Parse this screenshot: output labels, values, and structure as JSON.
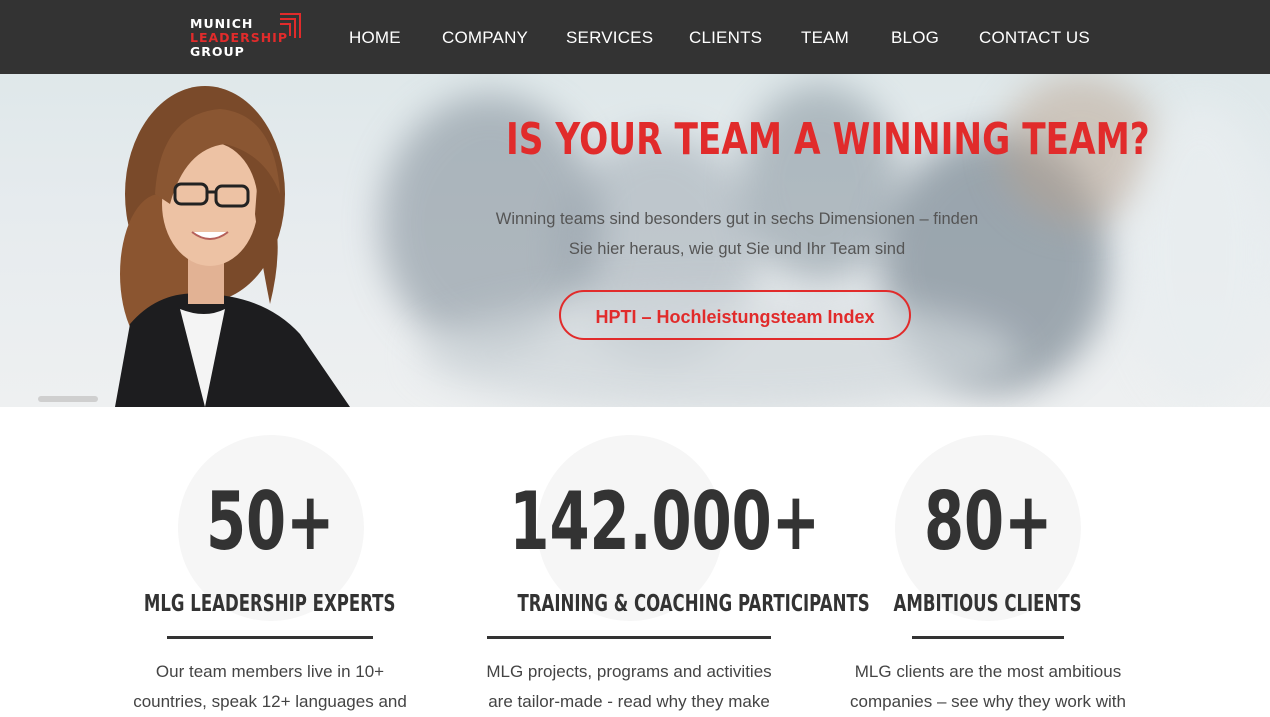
{
  "brand": {
    "line1": "MUNICH",
    "line2": "LEADERSHIP",
    "line3": "GROUP",
    "accent": "#e12b2b",
    "nav_bg": "#333333"
  },
  "nav": {
    "items": [
      {
        "label": "HOME"
      },
      {
        "label": "COMPANY"
      },
      {
        "label": "SERVICES"
      },
      {
        "label": "CLIENTS"
      },
      {
        "label": "TEAM"
      },
      {
        "label": "BLOG"
      },
      {
        "label": "CONTACT US"
      }
    ]
  },
  "hero": {
    "title": "IS YOUR TEAM A WINNING TEAM?",
    "subtitle_line1": "Winning teams sind besonders gut in sechs Dimensionen – finden",
    "subtitle_line2": "Sie hier heraus, wie gut Sie und Ihr Team sind",
    "button_label": "HPTI – Hochleistungsteam Index"
  },
  "stats": [
    {
      "number": "50+",
      "label": "MLG LEADERSHIP EXPERTS",
      "desc_line1": "Our team members live in 10+",
      "desc_line2": "countries, speak 12+ languages and"
    },
    {
      "number": "142.000+",
      "label": "TRAINING & COACHING PARTICIPANTS",
      "desc_line1": "MLG projects, programs and activities",
      "desc_line2": "are tailor-made - read why they make"
    },
    {
      "number": "80+",
      "label": "AMBITIOUS CLIENTS",
      "desc_line1": "MLG clients are the most ambitious",
      "desc_line2": "companies – see why they work with"
    }
  ]
}
